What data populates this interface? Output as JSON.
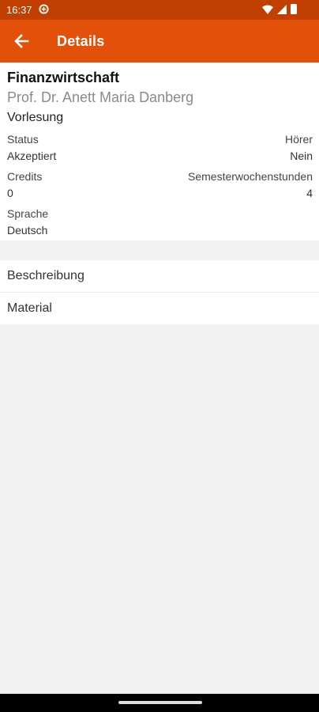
{
  "statusbar": {
    "time": "16:37"
  },
  "appbar": {
    "title": "Details"
  },
  "course": {
    "title": "Finanzwirtschaft",
    "lecturer": "Prof. Dr. Anett Maria Danberg",
    "type": "Vorlesung"
  },
  "fields": {
    "status_label": "Status",
    "status_value": "Akzeptiert",
    "hoerer_label": "Hörer",
    "hoerer_value": "Nein",
    "credits_label": "Credits",
    "credits_value": "0",
    "sws_label": "Semesterwochenstunden",
    "sws_value": "4",
    "sprache_label": "Sprache",
    "sprache_value": "Deutsch"
  },
  "list": [
    {
      "label": "Beschreibung"
    },
    {
      "label": "Material"
    }
  ],
  "colors": {
    "statusbar": "#c13f00",
    "appbar": "#e2500a",
    "background": "#f2f2f2"
  },
  "icons": {
    "back": "arrow-left-icon",
    "vpn": "vpn-icon",
    "wifi": "wifi-icon",
    "signal": "signal-icon",
    "battery": "battery-icon"
  }
}
